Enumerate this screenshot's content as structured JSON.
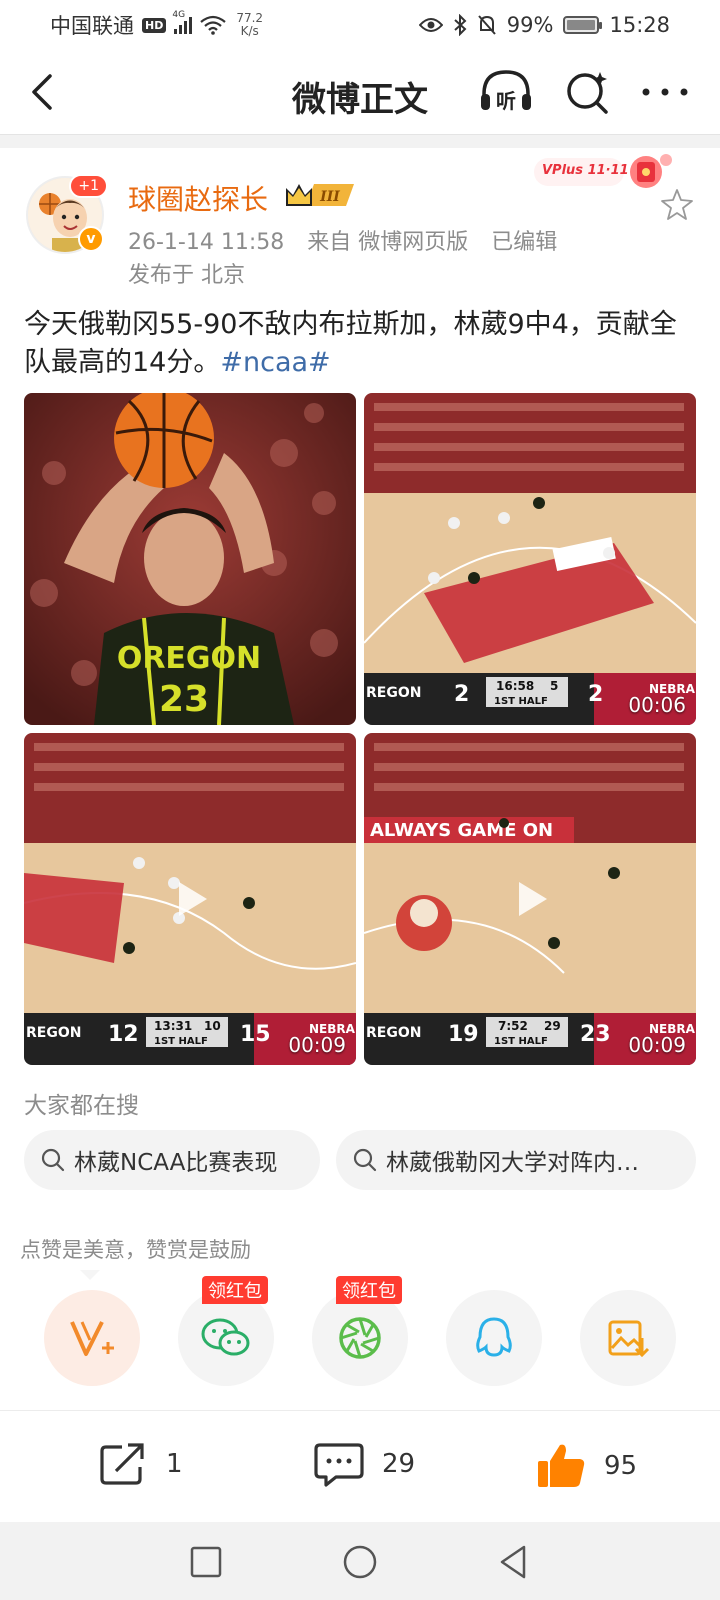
{
  "status_bar": {
    "carrier": "中国联通",
    "hd": "HD",
    "network": "4G",
    "speed_value": "77.2",
    "speed_unit": "K/s",
    "battery": "99%",
    "time": "15:28"
  },
  "nav": {
    "title": "微博正文",
    "listen_label": "听"
  },
  "post": {
    "username": "球圈赵探长",
    "avatar_badge": "+1",
    "vip_level": "III",
    "vplus_label": "VPlus 11·11",
    "date": "26-1-14 11:58",
    "source": "来自 微博网页版",
    "edited": "已编辑",
    "location": "发布于 北京",
    "text": "今天俄勒冈55-90不敌内布拉斯加，林葳9中4，贡献全队最高的14分。",
    "hashtag": "#ncaa#",
    "media": [
      {
        "type": "image",
        "jersey_team": "OREGON",
        "jersey_number": "23"
      },
      {
        "type": "video",
        "duration": "00:06",
        "score_home": "2",
        "score_away": "2",
        "clock": "16:58",
        "shot": "5",
        "period": "1ST HALF",
        "team_left": "REGON",
        "team_right": "NEBRA"
      },
      {
        "type": "video",
        "duration": "00:09",
        "score_home": "12",
        "score_away": "15",
        "clock": "13:31",
        "shot": "10",
        "period": "1ST HALF",
        "team_left": "REGON",
        "team_right": "NEBRA"
      },
      {
        "type": "video",
        "duration": "00:09",
        "score_home": "19",
        "score_away": "23",
        "clock": "7:52",
        "shot": "29",
        "period": "1ST HALF",
        "team_left": "REGON",
        "team_right": "NEBRA",
        "banner": "ALWAYS GAME ON"
      }
    ]
  },
  "search": {
    "title": "大家都在搜",
    "chips": [
      "林葳NCAA比赛表现",
      "林葳俄勒冈大学对阵内…"
    ]
  },
  "share": {
    "hint": "点赞是美意，赞赏是鼓励",
    "redpacket_label": "领红包"
  },
  "actions": {
    "reposts": "1",
    "comments": "29",
    "likes": "95"
  },
  "colors": {
    "username": "#e86a10",
    "hashtag": "#3f6ca8",
    "like": "#ff8200",
    "redpacket": "#ff3b30"
  }
}
